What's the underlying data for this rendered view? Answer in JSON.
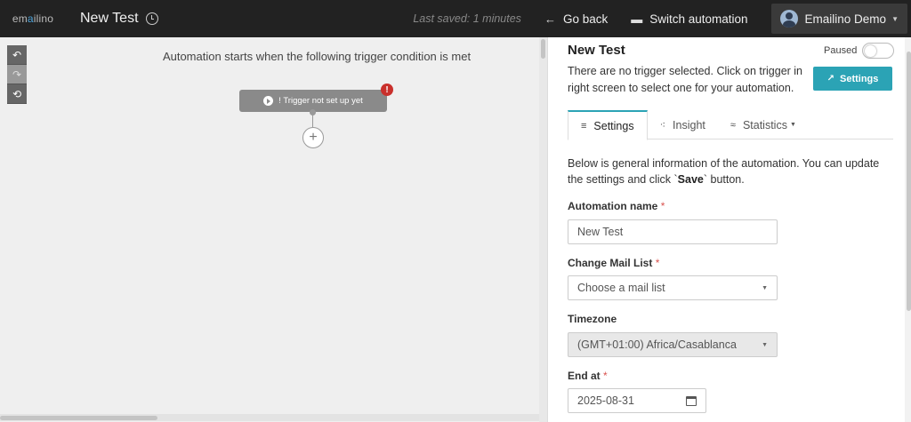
{
  "brand": {
    "logo_prefix": "em",
    "logo_accent": "a",
    "logo_suffix": "ilino"
  },
  "header": {
    "title": "New Test",
    "last_saved": "Last saved: 1 minutes",
    "go_back": "Go back",
    "switch_automation": "Switch automation",
    "user_name": "Emailino Demo"
  },
  "canvas": {
    "message": "Automation starts when the following trigger condition is met",
    "trigger_label": "! Trigger not set up yet",
    "alert": "!",
    "add": "+"
  },
  "panel": {
    "title": "New Test",
    "paused_label": "Paused",
    "paused": false,
    "description": "There are no trigger selected. Click on trigger in right screen to select one for your automation.",
    "settings_button": "Settings",
    "tabs": [
      {
        "label": "Settings",
        "active": true
      },
      {
        "label": "Insight",
        "active": false
      },
      {
        "label": "Statistics",
        "active": false
      }
    ],
    "intro_before": "Below is general information of the automation. You can update the settings and click `",
    "intro_bold": "Save",
    "intro_after": "` button.",
    "fields": {
      "name_label": "Automation name",
      "name_value": "New Test",
      "list_label": "Change Mail List",
      "list_placeholder": "Choose a mail list",
      "tz_label": "Timezone",
      "tz_value": "(GMT+01:00) Africa/Casablanca",
      "end_label": "End at",
      "end_value": "2025-08-31",
      "required_mark": "*"
    }
  },
  "colors": {
    "accent": "#2ba3b5",
    "topbar": "#222222",
    "error": "#c9302c"
  }
}
